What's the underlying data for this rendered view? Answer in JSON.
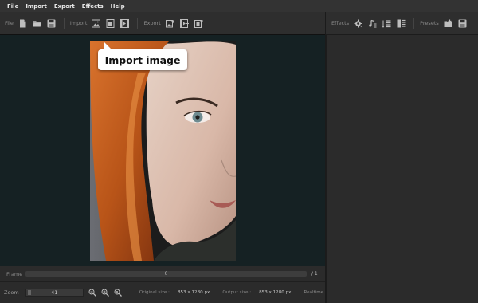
{
  "menu": [
    {
      "label": "File"
    },
    {
      "label": "Import"
    },
    {
      "label": "Export"
    },
    {
      "label": "Effects"
    },
    {
      "label": "Help"
    }
  ],
  "toolbar": {
    "file_label": "File",
    "import_label": "Import",
    "export_label": "Export",
    "file_icons": [
      "new-file-icon",
      "open-folder-icon",
      "save-icon"
    ],
    "import_icons": [
      "import-image-icon",
      "import-image-sequence-icon",
      "import-video-icon"
    ],
    "export_icons": [
      "export-image-icon",
      "export-video-icon",
      "export-gif-icon"
    ]
  },
  "side_toolbar": {
    "effects_label": "Effects",
    "presets_label": "Presets",
    "effects_icons": [
      "effects-gear-icon",
      "audio-note-icon",
      "list-icon",
      "layers-icon"
    ],
    "presets_icons": [
      "add-preset-icon",
      "save-preset-icon"
    ]
  },
  "tooltip": {
    "text": "Import image"
  },
  "frame": {
    "label": "Frame",
    "value": "0",
    "total": "/ 1"
  },
  "status": {
    "zoom_label": "Zoom",
    "zoom_value": "41",
    "original_size_label": "Original size :",
    "original_size_value": "853 x 1280 px",
    "output_size_label": "Output size :",
    "output_size_value": "853 x 1280 px",
    "realtime_label": "Realtime"
  },
  "colors": {
    "menubar": "#333333",
    "canvas": "#152123",
    "panel": "#2b2b2b",
    "tooltip": "#ffffff"
  }
}
